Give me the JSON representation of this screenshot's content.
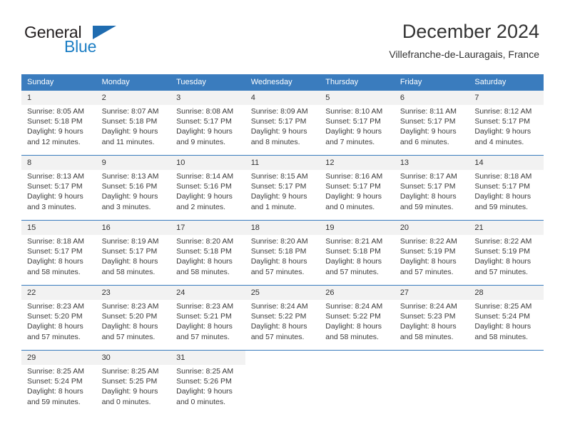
{
  "brand": {
    "name_part1": "General",
    "name_part2": "Blue",
    "triangle_icon": "blue-triangle-logo-mark",
    "accent_color": "#1f6cb0",
    "text_color": "#231f20"
  },
  "header": {
    "title": "December 2024",
    "subtitle": "Villefranche-de-Lauragais, France"
  },
  "calendar": {
    "header_bg": "#3a7cbe",
    "daynum_bg": "#f2f2f2",
    "weekday_headers": [
      "Sunday",
      "Monday",
      "Tuesday",
      "Wednesday",
      "Thursday",
      "Friday",
      "Saturday"
    ],
    "weeks": [
      [
        {
          "day": "1",
          "sunrise": "Sunrise: 8:05 AM",
          "sunset": "Sunset: 5:18 PM",
          "daylight_line1": "Daylight: 9 hours",
          "daylight_line2": "and 12 minutes."
        },
        {
          "day": "2",
          "sunrise": "Sunrise: 8:07 AM",
          "sunset": "Sunset: 5:18 PM",
          "daylight_line1": "Daylight: 9 hours",
          "daylight_line2": "and 11 minutes."
        },
        {
          "day": "3",
          "sunrise": "Sunrise: 8:08 AM",
          "sunset": "Sunset: 5:17 PM",
          "daylight_line1": "Daylight: 9 hours",
          "daylight_line2": "and 9 minutes."
        },
        {
          "day": "4",
          "sunrise": "Sunrise: 8:09 AM",
          "sunset": "Sunset: 5:17 PM",
          "daylight_line1": "Daylight: 9 hours",
          "daylight_line2": "and 8 minutes."
        },
        {
          "day": "5",
          "sunrise": "Sunrise: 8:10 AM",
          "sunset": "Sunset: 5:17 PM",
          "daylight_line1": "Daylight: 9 hours",
          "daylight_line2": "and 7 minutes."
        },
        {
          "day": "6",
          "sunrise": "Sunrise: 8:11 AM",
          "sunset": "Sunset: 5:17 PM",
          "daylight_line1": "Daylight: 9 hours",
          "daylight_line2": "and 6 minutes."
        },
        {
          "day": "7",
          "sunrise": "Sunrise: 8:12 AM",
          "sunset": "Sunset: 5:17 PM",
          "daylight_line1": "Daylight: 9 hours",
          "daylight_line2": "and 4 minutes."
        }
      ],
      [
        {
          "day": "8",
          "sunrise": "Sunrise: 8:13 AM",
          "sunset": "Sunset: 5:17 PM",
          "daylight_line1": "Daylight: 9 hours",
          "daylight_line2": "and 3 minutes."
        },
        {
          "day": "9",
          "sunrise": "Sunrise: 8:13 AM",
          "sunset": "Sunset: 5:16 PM",
          "daylight_line1": "Daylight: 9 hours",
          "daylight_line2": "and 3 minutes."
        },
        {
          "day": "10",
          "sunrise": "Sunrise: 8:14 AM",
          "sunset": "Sunset: 5:16 PM",
          "daylight_line1": "Daylight: 9 hours",
          "daylight_line2": "and 2 minutes."
        },
        {
          "day": "11",
          "sunrise": "Sunrise: 8:15 AM",
          "sunset": "Sunset: 5:17 PM",
          "daylight_line1": "Daylight: 9 hours",
          "daylight_line2": "and 1 minute."
        },
        {
          "day": "12",
          "sunrise": "Sunrise: 8:16 AM",
          "sunset": "Sunset: 5:17 PM",
          "daylight_line1": "Daylight: 9 hours",
          "daylight_line2": "and 0 minutes."
        },
        {
          "day": "13",
          "sunrise": "Sunrise: 8:17 AM",
          "sunset": "Sunset: 5:17 PM",
          "daylight_line1": "Daylight: 8 hours",
          "daylight_line2": "and 59 minutes."
        },
        {
          "day": "14",
          "sunrise": "Sunrise: 8:18 AM",
          "sunset": "Sunset: 5:17 PM",
          "daylight_line1": "Daylight: 8 hours",
          "daylight_line2": "and 59 minutes."
        }
      ],
      [
        {
          "day": "15",
          "sunrise": "Sunrise: 8:18 AM",
          "sunset": "Sunset: 5:17 PM",
          "daylight_line1": "Daylight: 8 hours",
          "daylight_line2": "and 58 minutes."
        },
        {
          "day": "16",
          "sunrise": "Sunrise: 8:19 AM",
          "sunset": "Sunset: 5:17 PM",
          "daylight_line1": "Daylight: 8 hours",
          "daylight_line2": "and 58 minutes."
        },
        {
          "day": "17",
          "sunrise": "Sunrise: 8:20 AM",
          "sunset": "Sunset: 5:18 PM",
          "daylight_line1": "Daylight: 8 hours",
          "daylight_line2": "and 58 minutes."
        },
        {
          "day": "18",
          "sunrise": "Sunrise: 8:20 AM",
          "sunset": "Sunset: 5:18 PM",
          "daylight_line1": "Daylight: 8 hours",
          "daylight_line2": "and 57 minutes."
        },
        {
          "day": "19",
          "sunrise": "Sunrise: 8:21 AM",
          "sunset": "Sunset: 5:18 PM",
          "daylight_line1": "Daylight: 8 hours",
          "daylight_line2": "and 57 minutes."
        },
        {
          "day": "20",
          "sunrise": "Sunrise: 8:22 AM",
          "sunset": "Sunset: 5:19 PM",
          "daylight_line1": "Daylight: 8 hours",
          "daylight_line2": "and 57 minutes."
        },
        {
          "day": "21",
          "sunrise": "Sunrise: 8:22 AM",
          "sunset": "Sunset: 5:19 PM",
          "daylight_line1": "Daylight: 8 hours",
          "daylight_line2": "and 57 minutes."
        }
      ],
      [
        {
          "day": "22",
          "sunrise": "Sunrise: 8:23 AM",
          "sunset": "Sunset: 5:20 PM",
          "daylight_line1": "Daylight: 8 hours",
          "daylight_line2": "and 57 minutes."
        },
        {
          "day": "23",
          "sunrise": "Sunrise: 8:23 AM",
          "sunset": "Sunset: 5:20 PM",
          "daylight_line1": "Daylight: 8 hours",
          "daylight_line2": "and 57 minutes."
        },
        {
          "day": "24",
          "sunrise": "Sunrise: 8:23 AM",
          "sunset": "Sunset: 5:21 PM",
          "daylight_line1": "Daylight: 8 hours",
          "daylight_line2": "and 57 minutes."
        },
        {
          "day": "25",
          "sunrise": "Sunrise: 8:24 AM",
          "sunset": "Sunset: 5:22 PM",
          "daylight_line1": "Daylight: 8 hours",
          "daylight_line2": "and 57 minutes."
        },
        {
          "day": "26",
          "sunrise": "Sunrise: 8:24 AM",
          "sunset": "Sunset: 5:22 PM",
          "daylight_line1": "Daylight: 8 hours",
          "daylight_line2": "and 58 minutes."
        },
        {
          "day": "27",
          "sunrise": "Sunrise: 8:24 AM",
          "sunset": "Sunset: 5:23 PM",
          "daylight_line1": "Daylight: 8 hours",
          "daylight_line2": "and 58 minutes."
        },
        {
          "day": "28",
          "sunrise": "Sunrise: 8:25 AM",
          "sunset": "Sunset: 5:24 PM",
          "daylight_line1": "Daylight: 8 hours",
          "daylight_line2": "and 58 minutes."
        }
      ],
      [
        {
          "day": "29",
          "sunrise": "Sunrise: 8:25 AM",
          "sunset": "Sunset: 5:24 PM",
          "daylight_line1": "Daylight: 8 hours",
          "daylight_line2": "and 59 minutes."
        },
        {
          "day": "30",
          "sunrise": "Sunrise: 8:25 AM",
          "sunset": "Sunset: 5:25 PM",
          "daylight_line1": "Daylight: 9 hours",
          "daylight_line2": "and 0 minutes."
        },
        {
          "day": "31",
          "sunrise": "Sunrise: 8:25 AM",
          "sunset": "Sunset: 5:26 PM",
          "daylight_line1": "Daylight: 9 hours",
          "daylight_line2": "and 0 minutes."
        },
        {
          "day": "",
          "sunrise": "",
          "sunset": "",
          "daylight_line1": "",
          "daylight_line2": ""
        },
        {
          "day": "",
          "sunrise": "",
          "sunset": "",
          "daylight_line1": "",
          "daylight_line2": ""
        },
        {
          "day": "",
          "sunrise": "",
          "sunset": "",
          "daylight_line1": "",
          "daylight_line2": ""
        },
        {
          "day": "",
          "sunrise": "",
          "sunset": "",
          "daylight_line1": "",
          "daylight_line2": ""
        }
      ]
    ]
  }
}
